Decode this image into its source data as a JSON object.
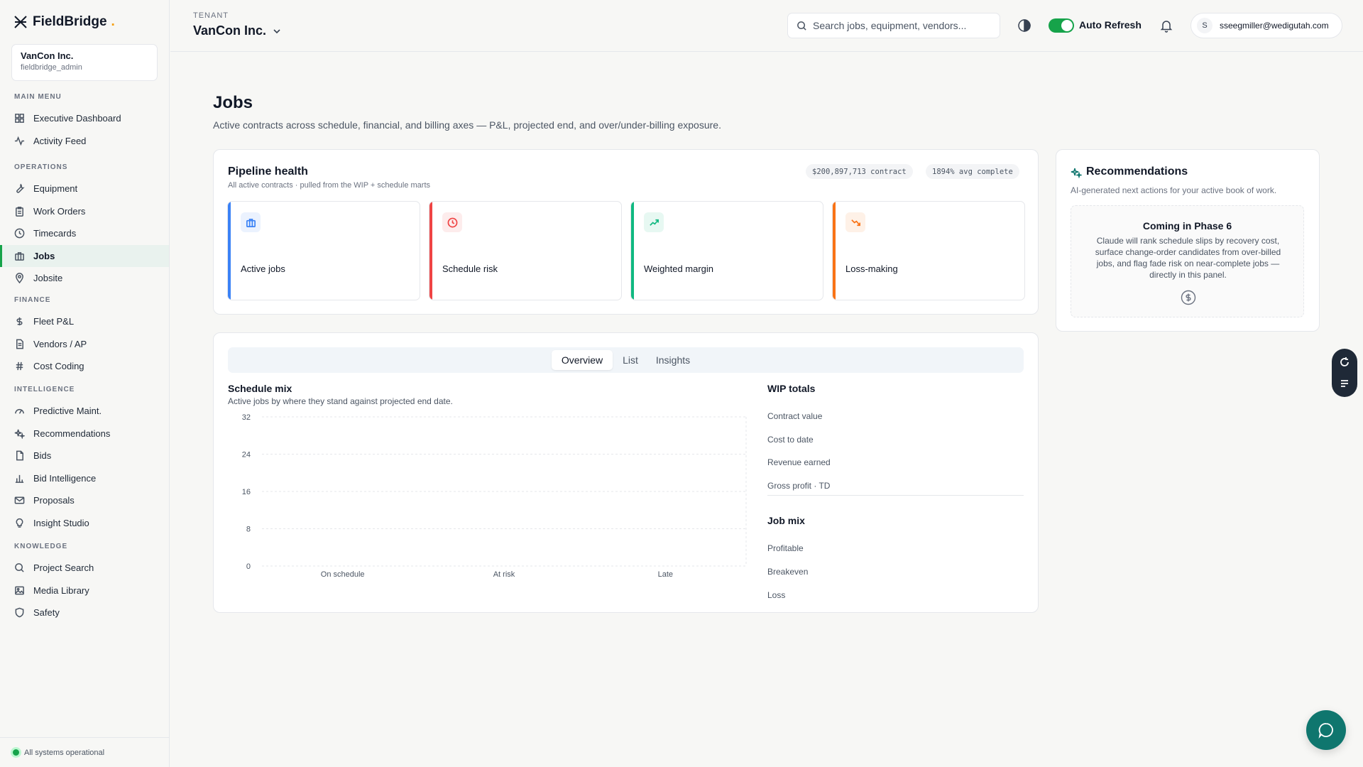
{
  "app": {
    "name": "FieldBridge",
    "accent": "#16a34a"
  },
  "tenant": {
    "label": "TENANT",
    "name": "VanCon Inc.",
    "card_name": "VanCon Inc.",
    "card_user": "fieldbridge_admin"
  },
  "sidebar": {
    "sections": [
      {
        "title": "MAIN MENU",
        "items": [
          {
            "label": "Executive Dashboard",
            "icon": "grid-icon"
          },
          {
            "label": "Activity Feed",
            "icon": "activity-icon"
          }
        ]
      },
      {
        "title": "OPERATIONS",
        "items": [
          {
            "label": "Equipment",
            "icon": "wrench-icon"
          },
          {
            "label": "Work Orders",
            "icon": "clipboard-icon"
          },
          {
            "label": "Timecards",
            "icon": "clock-icon"
          },
          {
            "label": "Jobs",
            "icon": "briefcase-icon",
            "active": true
          },
          {
            "label": "Jobsite",
            "icon": "map-pin-icon"
          }
        ]
      },
      {
        "title": "FINANCE",
        "items": [
          {
            "label": "Fleet P&L",
            "icon": "dollar-icon"
          },
          {
            "label": "Vendors / AP",
            "icon": "document-icon"
          },
          {
            "label": "Cost Coding",
            "icon": "hash-icon"
          }
        ]
      },
      {
        "title": "INTELLIGENCE",
        "items": [
          {
            "label": "Predictive Maint.",
            "icon": "gauge-icon"
          },
          {
            "label": "Recommendations",
            "icon": "sparkles-icon"
          },
          {
            "label": "Bids",
            "icon": "file-icon"
          },
          {
            "label": "Bid Intelligence",
            "icon": "bar-chart-icon"
          },
          {
            "label": "Proposals",
            "icon": "mail-icon"
          },
          {
            "label": "Insight Studio",
            "icon": "lightbulb-icon"
          }
        ]
      },
      {
        "title": "KNOWLEDGE",
        "items": [
          {
            "label": "Project Search",
            "icon": "search-icon"
          },
          {
            "label": "Media Library",
            "icon": "image-icon"
          },
          {
            "label": "Safety",
            "icon": "shield-icon"
          }
        ]
      }
    ],
    "status": "All systems operational"
  },
  "header": {
    "search_placeholder": "Search jobs, equipment, vendors...",
    "auto_refresh_label": "Auto Refresh",
    "auto_refresh_on": true,
    "user_initial": "S",
    "user_email": "sseegmiller@wedigutah.com"
  },
  "page": {
    "title": "Jobs",
    "subtitle": "Active contracts across schedule, financial, and billing axes — P&L, projected end, and over/under-billing exposure."
  },
  "pipeline": {
    "title": "Pipeline health",
    "subtitle": "All active contracts · pulled from the WIP + schedule marts",
    "pill_contract": "$200,897,713 contract",
    "pill_complete": "1894% avg complete",
    "kpis": [
      {
        "label": "Active jobs",
        "value": "",
        "sub": "",
        "color": "#3b82f6",
        "icon": "briefcase-icon"
      },
      {
        "label": "Schedule risk",
        "value": "",
        "sub": "",
        "color": "#ef4444",
        "icon": "clock-icon"
      },
      {
        "label": "Weighted margin",
        "value": "",
        "sub": "",
        "color": "#10b981",
        "icon": "trending-up-icon"
      },
      {
        "label": "Loss-making",
        "value": "",
        "sub": "",
        "color": "#f97316",
        "icon": "trending-down-icon"
      }
    ]
  },
  "tabs": [
    {
      "label": "Overview",
      "active": true
    },
    {
      "label": "List",
      "active": false
    },
    {
      "label": "Insights",
      "active": false
    }
  ],
  "schedule_mix": {
    "title": "Schedule mix",
    "subtitle": "Active jobs by where they stand against projected end date."
  },
  "chart_data": {
    "type": "bar",
    "categories": [
      "On schedule",
      "At risk",
      "Late"
    ],
    "values": [],
    "ylim": [
      0,
      32
    ],
    "yticks": [
      0,
      8,
      16,
      24,
      32
    ],
    "grid": true,
    "xlabel": "",
    "ylabel": ""
  },
  "wip": {
    "title": "WIP totals",
    "rows": [
      {
        "label": "Contract value",
        "value": ""
      },
      {
        "label": "Cost to date",
        "value": ""
      },
      {
        "label": "Revenue earned",
        "value": ""
      },
      {
        "label": "Gross profit · TD",
        "value": ""
      }
    ]
  },
  "job_mix": {
    "title": "Job mix",
    "rows": [
      {
        "label": "Profitable",
        "value": ""
      },
      {
        "label": "Breakeven",
        "value": ""
      },
      {
        "label": "Loss",
        "value": ""
      }
    ]
  },
  "recommendations": {
    "title": "Recommendations",
    "subtitle": "AI-generated next actions for your active book of work.",
    "box_title": "Coming in Phase 6",
    "box_body": "Claude will rank schedule slips by recovery cost, surface change-order candidates from over-billed jobs, and flag fade risk on near-complete jobs — directly in this panel."
  }
}
